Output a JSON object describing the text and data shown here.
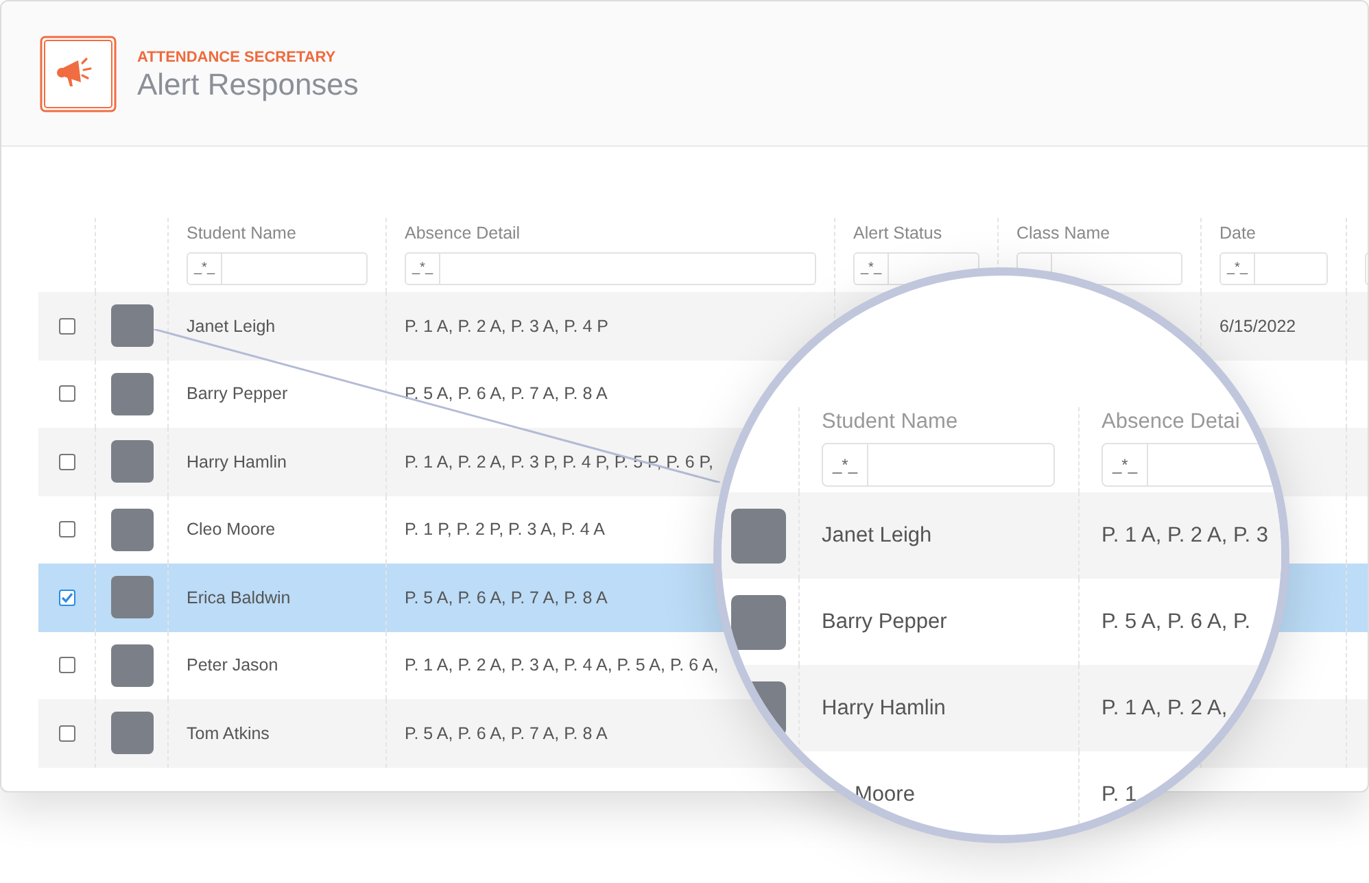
{
  "header": {
    "app": "ATTENDANCE SECRETARY",
    "title": "Alert Responses"
  },
  "table": {
    "columns": [
      {
        "label": "Student Name",
        "filter": "_*_"
      },
      {
        "label": "Absence Detail",
        "filter": "_*_"
      },
      {
        "label": "Alert Status",
        "filter": "_*_"
      },
      {
        "label": "Class Name"
      },
      {
        "label": "Date",
        "filter": "_*_"
      }
    ],
    "rows": [
      {
        "checked": false,
        "name": "Janet Leigh",
        "absence": "P. 1 A, P. 2 A, P. 3 A, P. 4 P",
        "date": "6/15/2022"
      },
      {
        "checked": false,
        "name": "Barry Pepper",
        "absence": "P. 5 A, P. 6 A, P. 7 A, P. 8 A"
      },
      {
        "checked": false,
        "name": "Harry Hamlin",
        "absence": "P. 1 A, P. 2 A, P. 3 P, P. 4 P, P. 5 P, P. 6 P,"
      },
      {
        "checked": false,
        "name": "Cleo Moore",
        "absence": "P. 1 P, P. 2 P, P. 3 A, P. 4 A"
      },
      {
        "checked": true,
        "name": "Erica Baldwin",
        "absence": "P. 5 A, P. 6 A, P. 7 A, P. 8 A"
      },
      {
        "checked": false,
        "name": "Peter Jason",
        "absence": "P. 1 A, P. 2 A, P. 3 A, P. 4 A, P. 5 A, P. 6 A,"
      },
      {
        "checked": false,
        "name": "Tom Atkins",
        "absence": "P. 5 A, P. 6 A, P. 7 A, P. 8 A"
      }
    ]
  },
  "magnifier": {
    "columns": [
      {
        "label": "Student Name",
        "filter": "_*_"
      },
      {
        "label": "Absence Detai",
        "filter": "_*_"
      }
    ],
    "rows": [
      {
        "name": "Janet Leigh",
        "absence": "P. 1 A, P. 2 A, P. 3"
      },
      {
        "name": "Barry Pepper",
        "absence": "P. 5 A, P. 6 A, P."
      },
      {
        "name": "Harry Hamlin",
        "absence": "P. 1 A, P. 2 A,"
      },
      {
        "name": "Moore",
        "absence": "P. 1"
      }
    ]
  }
}
